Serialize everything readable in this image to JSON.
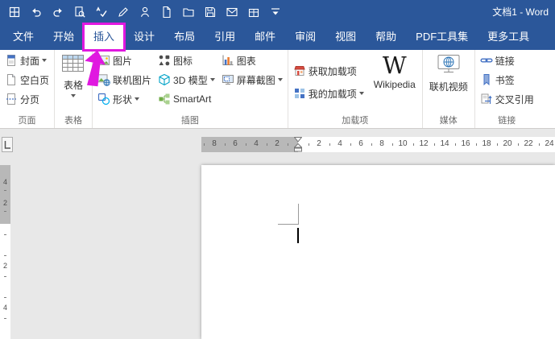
{
  "window": {
    "title": "文档1 - Word"
  },
  "colors": {
    "titlebar_blue": "#2b579a",
    "accent_blue": "#4472c4",
    "highlight_magenta": "#e018e0"
  },
  "tabs": [
    {
      "label": "文件",
      "active": false
    },
    {
      "label": "开始",
      "active": false
    },
    {
      "label": "插入",
      "active": true
    },
    {
      "label": "设计",
      "active": false
    },
    {
      "label": "布局",
      "active": false
    },
    {
      "label": "引用",
      "active": false
    },
    {
      "label": "邮件",
      "active": false
    },
    {
      "label": "审阅",
      "active": false
    },
    {
      "label": "视图",
      "active": false
    },
    {
      "label": "帮助",
      "active": false
    },
    {
      "label": "PDF工具集",
      "active": false
    },
    {
      "label": "更多工具",
      "active": false
    }
  ],
  "ribbon": {
    "groups": [
      {
        "label": "页面",
        "buttons": [
          {
            "label": "封面",
            "dropdown": true
          },
          {
            "label": "空白页",
            "dropdown": false
          },
          {
            "label": "分页",
            "dropdown": false
          }
        ]
      },
      {
        "label": "表格",
        "buttons": [
          {
            "label": "表格",
            "dropdown": true
          }
        ]
      },
      {
        "label": "插图",
        "buttons": [
          {
            "label": "图片",
            "dropdown": false
          },
          {
            "label": "联机图片",
            "dropdown": false
          },
          {
            "label": "形状",
            "dropdown": true
          },
          {
            "label": "图标",
            "dropdown": false
          },
          {
            "label": "3D 模型",
            "dropdown": true
          },
          {
            "label": "SmartArt",
            "dropdown": false
          },
          {
            "label": "图表",
            "dropdown": false
          },
          {
            "label": "屏幕截图",
            "dropdown": true
          }
        ]
      },
      {
        "label": "加载项",
        "buttons": [
          {
            "label": "获取加载项",
            "dropdown": false
          },
          {
            "label": "我的加载项",
            "dropdown": true
          },
          {
            "label": "Wikipedia",
            "dropdown": false
          }
        ]
      },
      {
        "label": "媒体",
        "buttons": [
          {
            "label": "联机视频",
            "dropdown": false
          }
        ]
      },
      {
        "label": "链接",
        "buttons": [
          {
            "label": "链接",
            "dropdown": false
          },
          {
            "label": "书签",
            "dropdown": false
          },
          {
            "label": "交叉引用",
            "dropdown": false
          }
        ]
      }
    ]
  },
  "ruler": {
    "h_margin": [
      "8",
      "6",
      "4",
      "2"
    ],
    "h_main": [
      "2",
      "4",
      "6",
      "8",
      "10",
      "12",
      "14",
      "16",
      "18",
      "20",
      "22",
      "24"
    ],
    "v_margin": [
      "4",
      "2"
    ],
    "v_main": [
      "2",
      "4"
    ]
  },
  "annotation": {
    "type": "highlight-box-with-arrow",
    "target_tab": "插入",
    "color": "#e018e0"
  },
  "icons": {
    "qat": [
      "word-app-icon",
      "undo-icon",
      "redo-icon",
      "print-preview-icon",
      "spelling-check-icon",
      "edit-document-icon",
      "signature-icon",
      "new-document-icon",
      "open-folder-icon",
      "save-icon",
      "email-icon",
      "package-icon",
      "customize-qat-icon"
    ],
    "ribbon": [
      "cover-page-icon",
      "blank-page-icon",
      "page-break-icon",
      "table-icon",
      "picture-icon",
      "online-pictures-icon",
      "shapes-icon",
      "icons-icon",
      "three-d-model-icon",
      "smartart-icon",
      "chart-icon",
      "screenshot-icon",
      "get-addins-icon",
      "my-addins-icon",
      "wikipedia-icon",
      "online-video-icon",
      "link-icon",
      "bookmark-icon",
      "cross-reference-icon"
    ],
    "ruler": [
      "tab-selector-icon",
      "first-line-indent-marker",
      "hanging-indent-marker"
    ]
  }
}
